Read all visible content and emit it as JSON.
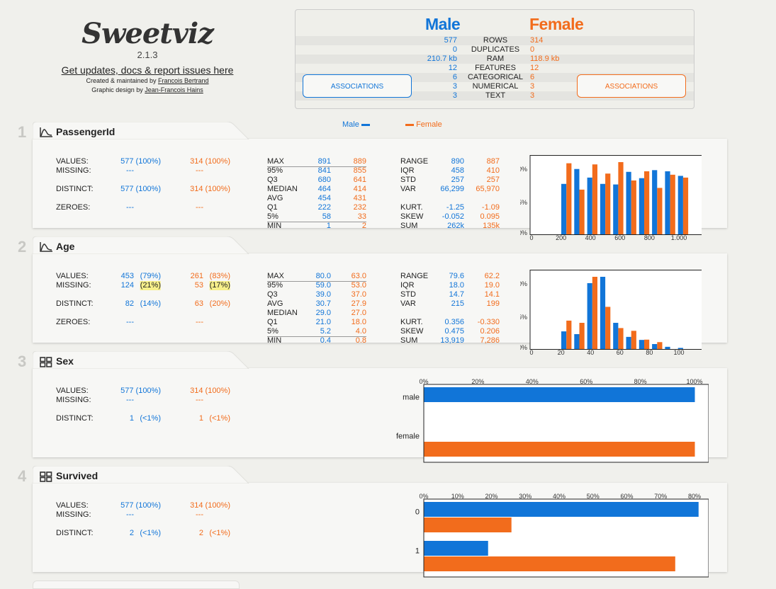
{
  "header": {
    "logo_text": "Sweetviz",
    "version": "2.1.3",
    "updates_link": "Get updates, docs & report issues here",
    "credit_prefix": "Created & maintained by ",
    "credit_author": "Francois Bertrand",
    "design_prefix": "Graphic design by ",
    "design_author": "Jean-Francois Hains"
  },
  "summary": {
    "left_title": "Male",
    "right_title": "Female",
    "rows": [
      {
        "label": "ROWS",
        "left": "577",
        "right": "314"
      },
      {
        "label": "DUPLICATES",
        "left": "0",
        "right": "0"
      },
      {
        "label": "RAM",
        "left": "210.7 kb",
        "right": "118.9 kb"
      },
      {
        "label": "FEATURES",
        "left": "12",
        "right": "12"
      },
      {
        "label": "CATEGORICAL",
        "left": "6",
        "right": "6"
      },
      {
        "label": "NUMERICAL",
        "left": "3",
        "right": "3"
      },
      {
        "label": "TEXT",
        "left": "3",
        "right": "3"
      }
    ],
    "assoc_left": "ASSOCIATIONS",
    "assoc_right": "ASSOCIATIONS"
  },
  "legend": {
    "left": "Male",
    "right": "Female",
    "left_color": "#1175d8",
    "right_color": "#f26c1c"
  },
  "features": [
    {
      "index": "1",
      "name": "PassengerId",
      "kind": "numeric",
      "values": [
        "577 (100%)",
        "314 (100%)"
      ],
      "missing": [
        "---",
        "---"
      ],
      "distinct": [
        "577 (100%)",
        "314 (100%)"
      ],
      "zeroes": [
        "---",
        "---"
      ],
      "stats1": [
        [
          "MAX",
          "891",
          "889"
        ],
        [
          "95%",
          "841",
          "855"
        ],
        [
          "Q3",
          "680",
          "641"
        ],
        [
          "MEDIAN",
          "464",
          "414"
        ],
        [
          "AVG",
          "454",
          "431"
        ],
        [
          "Q1",
          "222",
          "232"
        ],
        [
          "5%",
          "58",
          "33"
        ],
        [
          "MIN",
          "1",
          "2"
        ]
      ],
      "stats2": [
        [
          "RANGE",
          "890",
          "887"
        ],
        [
          "IQR",
          "458",
          "410"
        ],
        [
          "STD",
          "257",
          "257"
        ],
        [
          "VAR",
          "66,299",
          "65,970"
        ]
      ],
      "stats3": [
        [
          "KURT.",
          "-1.25",
          "-1.09"
        ],
        [
          "SKEW",
          "-0.052",
          "0.095"
        ],
        [
          "SUM",
          "262k",
          "135k"
        ]
      ]
    },
    {
      "index": "2",
      "name": "Age",
      "kind": "numeric",
      "values": [
        "453",
        "(79%)",
        "261",
        "(83%)"
      ],
      "missing": [
        "124",
        "(21%)",
        "53",
        "(17%)"
      ],
      "distinct": [
        "82",
        "(14%)",
        "63",
        "(20%)"
      ],
      "zeroes": [
        "---",
        "---"
      ],
      "stats1": [
        [
          "MAX",
          "80.0",
          "63.0"
        ],
        [
          "95%",
          "59.0",
          "53.0"
        ],
        [
          "Q3",
          "39.0",
          "37.0"
        ],
        [
          "AVG",
          "30.7",
          "27.9"
        ],
        [
          "MEDIAN",
          "29.0",
          "27.0"
        ],
        [
          "Q1",
          "21.0",
          "18.0"
        ],
        [
          "5%",
          "5.2",
          "4.0"
        ],
        [
          "MIN",
          "0.4",
          "0.8"
        ]
      ],
      "stats2": [
        [
          "RANGE",
          "79.6",
          "62.2"
        ],
        [
          "IQR",
          "18.0",
          "19.0"
        ],
        [
          "STD",
          "14.7",
          "14.1"
        ],
        [
          "VAR",
          "215",
          "199"
        ]
      ],
      "stats3": [
        [
          "KURT.",
          "0.356",
          "-0.330"
        ],
        [
          "SKEW",
          "0.475",
          "0.206"
        ],
        [
          "SUM",
          "13,919",
          "7,286"
        ]
      ]
    },
    {
      "index": "3",
      "name": "Sex",
      "kind": "categorical",
      "values": [
        "577 (100%)",
        "314 (100%)"
      ],
      "missing": [
        "---",
        "---"
      ],
      "distinct": [
        "1",
        "(<1%)",
        "1",
        "(<1%)"
      ]
    },
    {
      "index": "4",
      "name": "Survived",
      "kind": "categorical",
      "values": [
        "577 (100%)",
        "314 (100%)"
      ],
      "missing": [
        "---",
        "---"
      ],
      "distinct": [
        "2",
        "(<1%)",
        "2",
        "(<1%)"
      ]
    }
  ],
  "row_labels": {
    "values": "VALUES:",
    "missing": "MISSING:",
    "distinct": "DISTINCT:",
    "zeroes": "ZEROES:"
  },
  "chart_data": [
    {
      "type": "bar",
      "feature": "PassengerId",
      "x_ticks": [
        "0",
        "200",
        "400",
        "600",
        "800",
        "1,000"
      ],
      "series": [
        {
          "name": "Male",
          "values": [
            8.8,
            11.4,
            9.9,
            8.8,
            8.7,
            10.9,
            9.8,
            11.2,
            11.0,
            10.2
          ]
        },
        {
          "name": "Female",
          "values": [
            12.4,
            7.8,
            12.2,
            10.6,
            12.6,
            9.4,
            11.0,
            8.1,
            10.4,
            9.9
          ]
        }
      ]
    },
    {
      "type": "bar",
      "feature": "Age",
      "x_ticks": [
        "0",
        "20",
        "40",
        "60",
        "80",
        "100"
      ],
      "series": [
        {
          "name": "Male",
          "values": [
            6.4,
            5.4,
            23.9,
            26.2,
            9.5,
            4.4,
            3.3,
            1.8,
            0.8,
            0.4
          ]
        },
        {
          "name": "Female",
          "values": [
            10.3,
            9.5,
            26.2,
            15.3,
            7.6,
            6.6,
            3.4,
            2.5,
            0,
            0
          ]
        }
      ]
    },
    {
      "type": "bar",
      "orientation": "horizontal",
      "feature": "Sex",
      "categories": [
        "male",
        "female"
      ],
      "x_ticks": [
        "0%",
        "20%",
        "40%",
        "60%",
        "80%",
        "100%"
      ],
      "series": [
        {
          "name": "Male",
          "values": [
            100,
            0
          ]
        },
        {
          "name": "Female",
          "values": [
            0,
            100
          ]
        }
      ]
    },
    {
      "type": "bar",
      "orientation": "horizontal",
      "feature": "Survived",
      "categories": [
        "0",
        "1"
      ],
      "x_ticks": [
        "0%",
        "10%",
        "20%",
        "30%",
        "40%",
        "50%",
        "60%",
        "70%",
        "80%"
      ],
      "series": [
        {
          "name": "Male",
          "values": [
            81.1,
            18.9
          ]
        },
        {
          "name": "Female",
          "values": [
            25.8,
            74.2
          ]
        }
      ]
    }
  ]
}
